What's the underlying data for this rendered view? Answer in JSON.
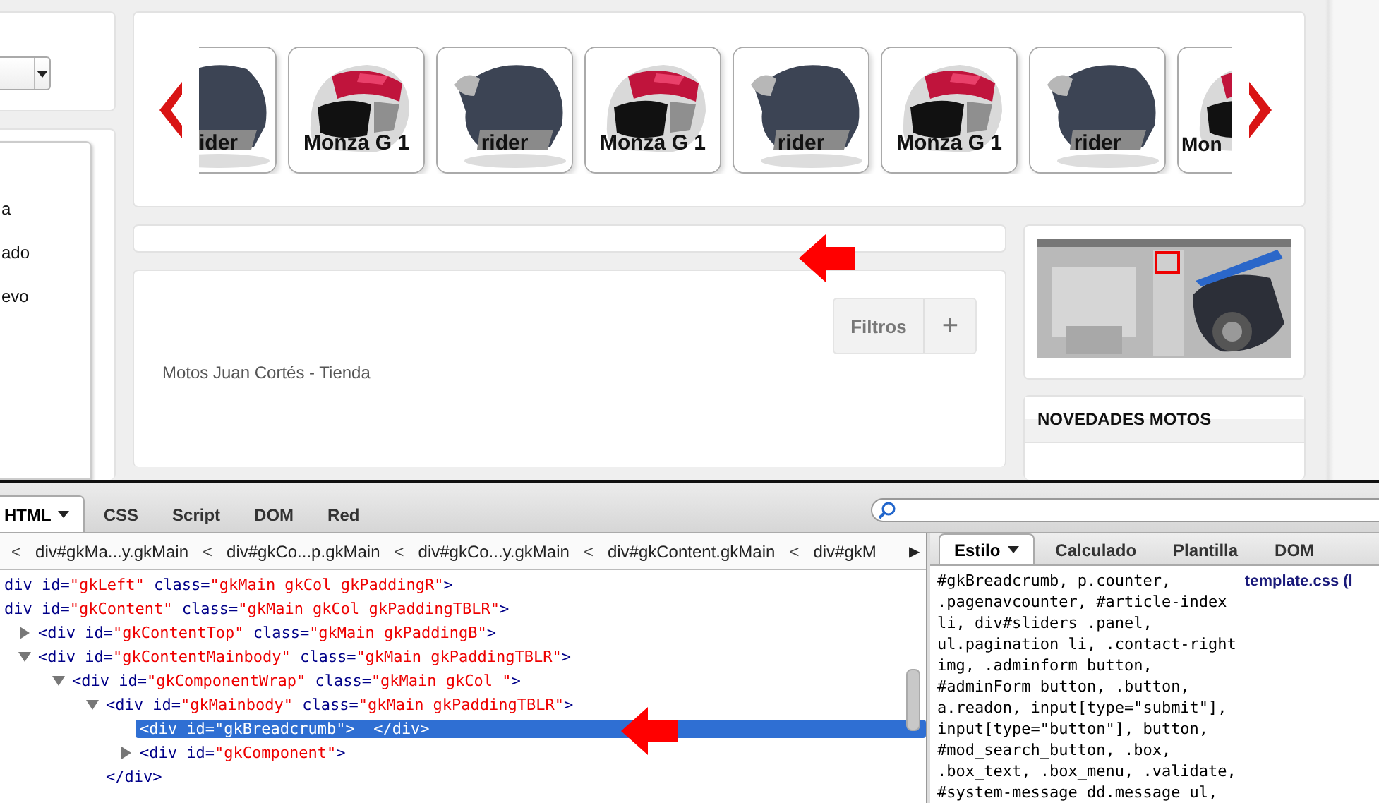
{
  "page": {
    "left_sidebar": {
      "menu_items": [
        {
          "label": "a"
        },
        {
          "label": "ado"
        },
        {
          "label": "evo"
        }
      ]
    },
    "carousel": {
      "items": [
        {
          "kind": "dark",
          "label": "ider"
        },
        {
          "kind": "striped",
          "label": "Monza G 1"
        },
        {
          "kind": "dark",
          "label": "rider"
        },
        {
          "kind": "striped",
          "label": "Monza G 1"
        },
        {
          "kind": "dark",
          "label": "rider"
        },
        {
          "kind": "striped",
          "label": "Monza G 1"
        },
        {
          "kind": "dark",
          "label": "rider"
        },
        {
          "kind": "striped",
          "label": "Mon"
        }
      ]
    },
    "content": {
      "filters_button": {
        "label": "Filtros",
        "add_label": "+"
      },
      "title": "Motos Juan Cortés - Tienda"
    },
    "news_module": {
      "title": "NOVEDADES MOTOS"
    }
  },
  "devtools": {
    "tabs": [
      {
        "label": "HTML",
        "selected": true,
        "has_menu": true
      },
      {
        "label": "CSS",
        "selected": false,
        "has_menu": false
      },
      {
        "label": "Script",
        "selected": false,
        "has_menu": false
      },
      {
        "label": "DOM",
        "selected": false,
        "has_menu": false
      },
      {
        "label": "Red",
        "selected": false,
        "has_menu": false
      }
    ],
    "breadcrumbs": [
      {
        "separator": "<",
        "label": "div#gkMa...y.gkMain"
      },
      {
        "separator": "<",
        "label": "div#gkCo...p.gkMain"
      },
      {
        "separator": "<",
        "label": "div#gkCo...y.gkMain"
      },
      {
        "separator": "<",
        "label": "div#gkContent.gkMain"
      },
      {
        "separator": "<",
        "label": "div#gkM"
      }
    ],
    "breadcrumbs_next": "▶",
    "html_tree": [
      {
        "tag": "div id=\"gkLeft\" class=\"gkMain gkCol gkPaddingR\">",
        "selected": false
      },
      {
        "tag": "div id=\"gkContent\" class=\"gkMain gkCol gkPaddingTBLR\">",
        "selected": false,
        "children": [
          {
            "tag": "<div id=\"gkContentTop\" class=\"gkMain gkPaddingB\">",
            "selected": false,
            "expanded": false
          },
          {
            "tag": "<div id=\"gkContentMainbody\" class=\"gkMain gkPaddingTBLR\">",
            "selected": false,
            "expanded": true,
            "children": [
              {
                "tag": "<div id=\"gkComponentWrap\" class=\"gkMain gkCol \">",
                "selected": false,
                "expanded": true,
                "children": [
                  {
                    "tag": "<div id=\"gkMainbody\" class=\"gkMain gkPaddingTBLR\">",
                    "selected": false,
                    "expanded": true,
                    "close": "</div>",
                    "children": [
                      {
                        "tag": "<div id=\"gkBreadcrumb\">  </div>",
                        "selected": true
                      },
                      {
                        "tag": "<div id=\"gkComponent\">",
                        "selected": false,
                        "expanded": false
                      }
                    ]
                  }
                ]
              }
            ]
          }
        ]
      }
    ],
    "side_tabs": [
      {
        "label": "Estilo",
        "selected": true,
        "has_menu": true
      },
      {
        "label": "Calculado",
        "selected": false,
        "has_menu": false
      },
      {
        "label": "Plantilla",
        "selected": false,
        "has_menu": false
      },
      {
        "label": "DOM",
        "selected": false,
        "has_menu": false
      }
    ],
    "css_rule": {
      "selector_lines": [
        "#gkBreadcrumb, p.counter,",
        ".pagenavcounter, #article-index",
        "li, div#sliders .panel,",
        "ul.pagination li, .contact-right",
        "img, .adminform button,",
        "#adminForm button, .button,",
        "a.readon, input[type=\"submit\"],",
        "input[type=\"button\"], button,",
        "#mod_search_button, .box,",
        ".box_text, .box_menu, .validate,",
        "#system-message dd.message ul,"
      ],
      "source": "template.css (l"
    }
  }
}
